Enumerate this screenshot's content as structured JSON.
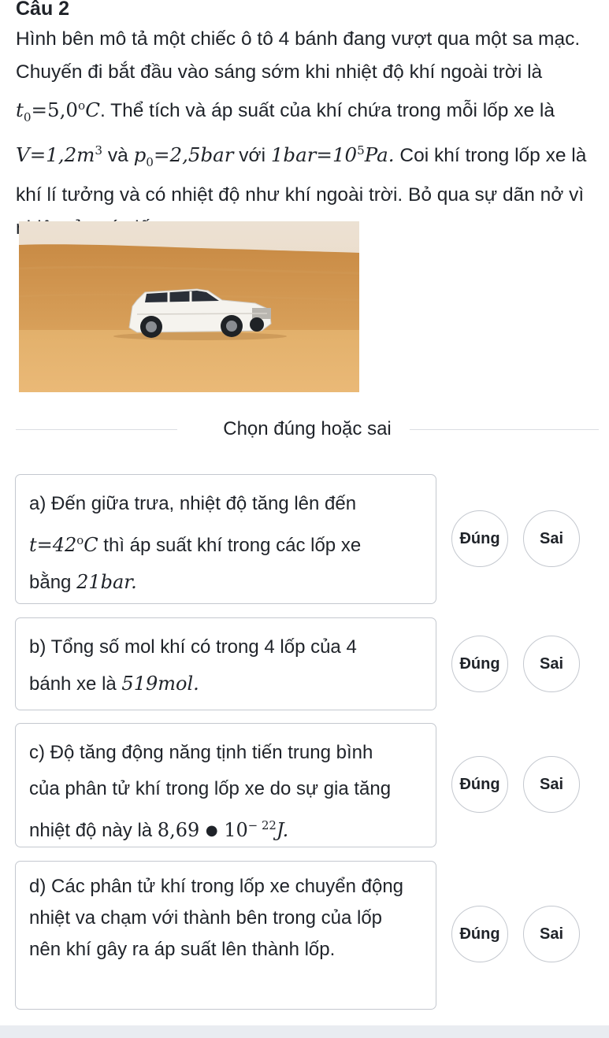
{
  "question": {
    "title": "Câu 2",
    "p1": "Hình bên mô tả một chiếc ô tô 4 bánh đang vượt qua một sa mạc. Chuyến đi bắt đầu vào sáng sớm khi nhiệt độ khí ngoài trời là ",
    "t0_var": "t",
    "t0_sub": "0",
    "t0_val": "=5,0",
    "t0_unit_sup": "o",
    "t0_unit": "C",
    "p2": ". Thể tích và áp suất của khí chứa trong mỗi lốp xe là ",
    "v_expr": "V=1,2m",
    "v_sup": "3",
    "va": " và ",
    "p0_var": "p",
    "p0_sub": "0",
    "p0_val": "=2,5bar",
    "voi": " với ",
    "bar_expr": "1bar=10",
    "bar_sup": "5",
    "bar_unit": "Pa.",
    "p3": " Coi khí trong lốp xe là khí lí tưởng và có nhiệt độ như khí ngoài trời. Bỏ qua sự dãn nở vì nhiệt của các lốp xe."
  },
  "image": {
    "subject": "desert-car-illustration"
  },
  "section": {
    "heading": "Chọn đúng hoặc sai"
  },
  "buttons": {
    "true_label": "Đúng",
    "false_label": "Sai"
  },
  "statements": [
    {
      "p1": "a) Đến giữa trưa, nhiệt độ tăng lên đến",
      "m1": "t=42",
      "m1_sup": "o",
      "m1_unit": "C",
      "p2": " thì áp suất khí trong các lốp xe",
      "p3": "bằng ",
      "m2": "21bar."
    },
    {
      "p1": "b) Tổng số mol khí có trong 4 lốp của 4",
      "p2": "bánh xe là ",
      "m1": "519mol."
    },
    {
      "p1": "c) Độ tăng động năng tịnh tiến trung bình",
      "p2": "của phân tử khí trong lốp xe do sự gia tăng",
      "p3": "nhiệt độ này là ",
      "m1": "8,69",
      "m2": "10",
      "m2_sup": "− 22",
      "m3": "J."
    },
    {
      "text": "d) Các phân tử khí trong lốp xe chuyển động nhiệt va chạm với thành bên trong của lốp nên khí gây ra áp suất lên thành lốp."
    }
  ],
  "colors": {
    "border": "#c4c8cf",
    "text": "#1f2329",
    "sand": "#d9a55a",
    "sky": "#e9dccb"
  }
}
